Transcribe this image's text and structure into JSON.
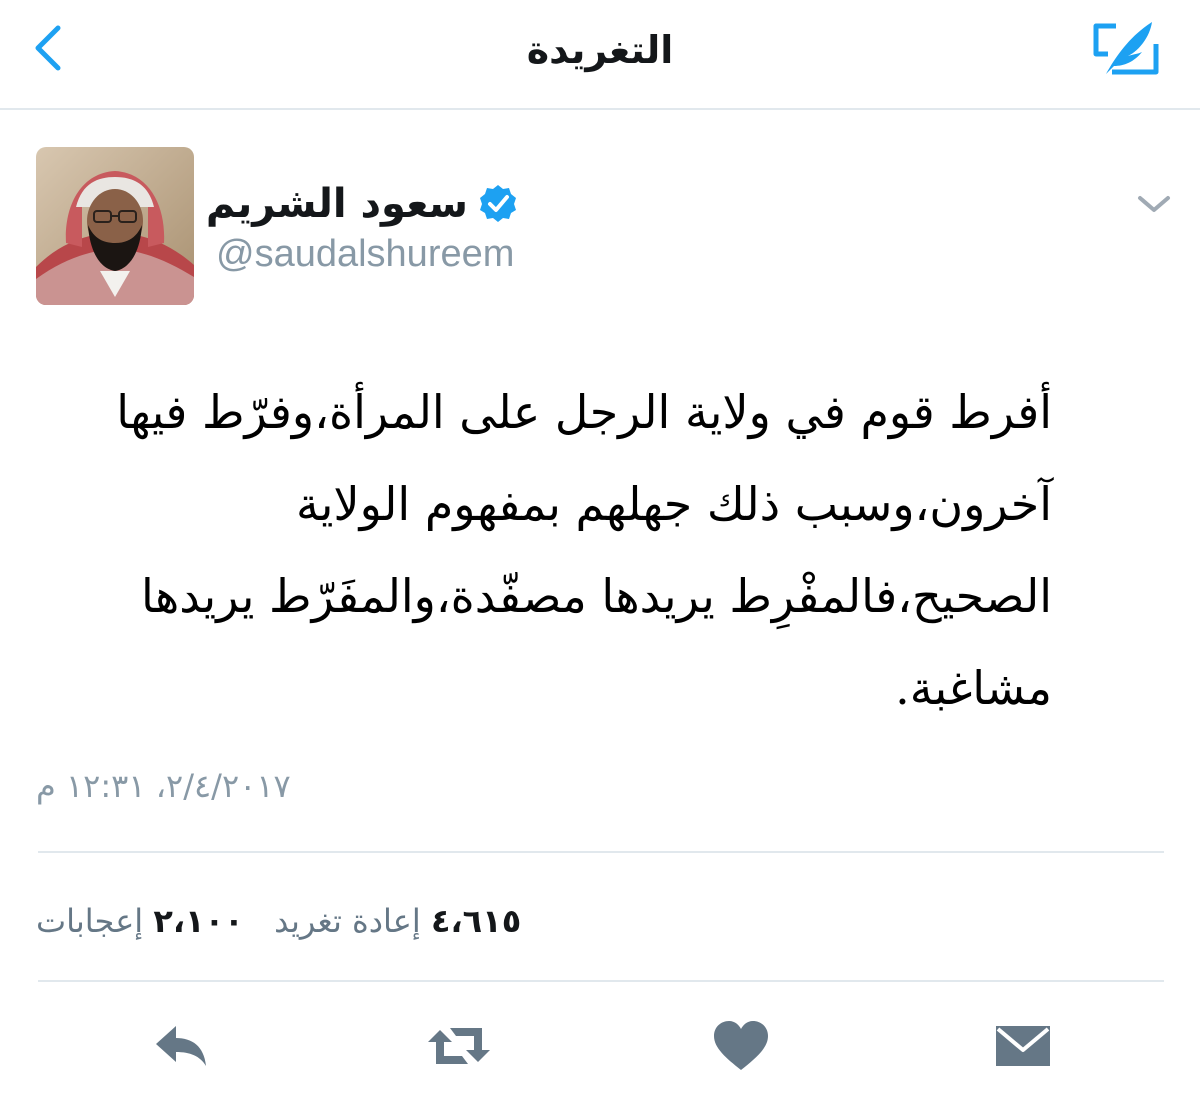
{
  "header": {
    "title": "التغريدة",
    "back_icon": "chevron-left-icon",
    "compose_icon": "compose-tweet-icon"
  },
  "tweet": {
    "author": {
      "display_name": "سعود الشريم",
      "handle": "@saudalshureem",
      "verified_icon": "verified-badge-icon"
    },
    "text_lines": [
      "أفرط قوم في ولاية الرجل على المرأة،وفرّط فيها",
      "آخرون،وسبب ذلك جهلهم بمفهوم الولاية",
      "الصحيح،فالمفْرِط يريدها مصفّدة،والمفَرّط يريدها",
      "مشاغبة."
    ],
    "timestamp": "٢/٤/٢٠١٧، ١٢:٣١ م",
    "stats": {
      "retweets_count": "٤،٦١٥",
      "retweets_label": "إعادة تغريد",
      "likes_count": "٢،١٠٠",
      "likes_label": "إعجابات"
    }
  },
  "actions": [
    {
      "name": "reply-button",
      "icon": "reply-icon"
    },
    {
      "name": "retweet-button",
      "icon": "retweet-icon"
    },
    {
      "name": "like-button",
      "icon": "heart-icon"
    },
    {
      "name": "direct-message-button",
      "icon": "envelope-icon"
    }
  ],
  "colors": {
    "accent": "#1da1f2",
    "icon_gray": "#657786",
    "muted_text": "#8899a6",
    "divider": "#e1e8ed"
  }
}
